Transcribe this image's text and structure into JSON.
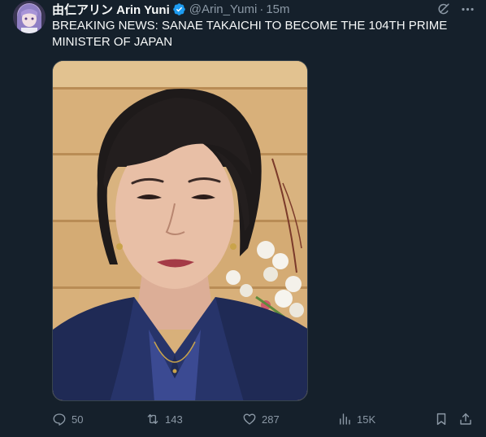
{
  "tweet": {
    "display_name": "由仁アリン Arin Yuni",
    "handle": "@Arin_Yumi",
    "separator": "·",
    "time": "15m",
    "text": "BREAKING NEWS: SANAE TAKAICHI TO BECOME THE 104TH PRIME MINISTER OF JAPAN"
  },
  "actions": {
    "replies": "50",
    "reposts": "143",
    "likes": "287",
    "views": "15K"
  },
  "icons": {
    "verified": "verified-badge-icon",
    "grok": "grok-icon",
    "more": "more-icon",
    "reply": "reply-icon",
    "repost": "repost-icon",
    "like": "heart-icon",
    "views": "views-icon",
    "bookmark": "bookmark-icon",
    "share": "share-icon"
  },
  "colors": {
    "background": "#15202b",
    "text": "#f7f9f9",
    "muted": "#8b98a5",
    "verified": "#1d9bf0"
  }
}
